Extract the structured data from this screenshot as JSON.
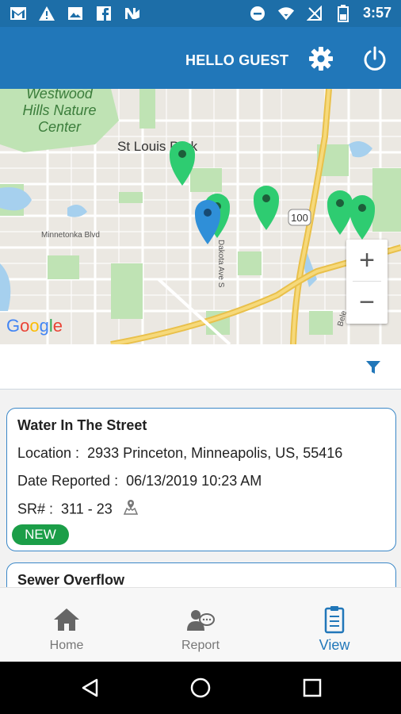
{
  "status_bar": {
    "time": "3:57",
    "icons_left": [
      "gmail-icon",
      "alert-icon",
      "image-icon",
      "facebook-icon",
      "news-icon"
    ],
    "icons_right": [
      "dnd-icon",
      "wifi-icon",
      "no-signal-icon",
      "battery-icon"
    ]
  },
  "header": {
    "greeting": "HELLO GUEST",
    "settings_icon": "gear-icon",
    "logout_icon": "power-icon",
    "background": "#2177b9"
  },
  "map": {
    "labels": {
      "park": [
        "Westwood",
        "Hills Nature",
        "Center"
      ],
      "city": "St Louis Park",
      "road_minnetonka": "Minnetonka Blvd",
      "road_dakota": "Dakota Ave S",
      "highway": "100",
      "road_right": "Bele"
    },
    "google_logo": "Google",
    "zoom_in": "+",
    "zoom_out": "−",
    "pin_colors": {
      "green": "#2ecc71",
      "blue": "#2f8fd8"
    }
  },
  "filter": {
    "icon": "filter-icon",
    "color": "#2177b9"
  },
  "requests": [
    {
      "title": "Water In The Street",
      "location_label": "Location :",
      "location": "2933 Princeton, Minneapolis, US, 55416",
      "date_label": "Date Reported :",
      "date": "06/13/2019 10:23 AM",
      "sr_label": "SR# :",
      "sr": "311 - 23",
      "status": "NEW"
    },
    {
      "title": "Sewer Overflow"
    }
  ],
  "bottom_nav": [
    {
      "label": "Home",
      "icon": "home-icon",
      "active": false
    },
    {
      "label": "Report",
      "icon": "report-icon",
      "active": false
    },
    {
      "label": "View",
      "icon": "clipboard-icon",
      "active": true
    }
  ],
  "colors": {
    "active": "#2177b9",
    "inactive": "#777777",
    "badge": "#1b9e48"
  }
}
